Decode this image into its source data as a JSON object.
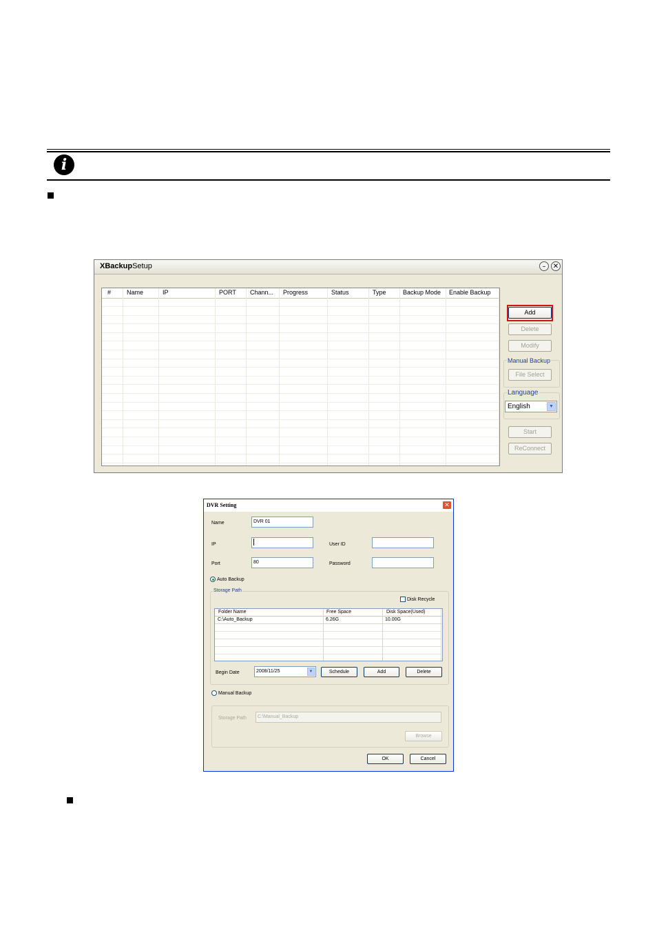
{
  "xbackup": {
    "title_bold": "XBackup",
    "title_rest": "Setup",
    "minimize_glyph": "–",
    "close_glyph": "✕",
    "columns": [
      "#",
      "Name",
      "IP",
      "PORT",
      "Chann...",
      "Progress",
      "Status",
      "Type",
      "Backup Mode",
      "Enable Backup"
    ],
    "buttons": {
      "add": "Add",
      "delete": "Delete",
      "modify": "Modify",
      "file_select": "File Select",
      "start": "Start",
      "reconnect": "ReConnect"
    },
    "manual_backup_label": "Manual Backup",
    "language_label": "Language",
    "language_value": "English"
  },
  "dvr": {
    "title": "DVR Setting",
    "close_glyph": "✕",
    "name_label": "Name",
    "name_value": "DVR 01",
    "ip_label": "IP",
    "ip_value": "",
    "userid_label": "User ID",
    "userid_value": "",
    "port_label": "Port",
    "port_value": "80",
    "password_label": "Password",
    "password_value": "",
    "auto_backup_label": "Auto Backup",
    "storage_path_label": "Storage Path",
    "disk_recycle_label": "Disk Recycle",
    "columns": [
      "Folder Name",
      "Free Space",
      "Disk Space(Used)"
    ],
    "rows": [
      {
        "folder": "C:\\Auto_Backup",
        "free": "6.26G",
        "used": "10.00G"
      }
    ],
    "begin_date_label": "Begin Date",
    "begin_date_value": "2008/11/25",
    "schedule_btn": "Schedule",
    "add_btn": "Add",
    "delete_btn": "Delete",
    "manual_backup_label": "Manual Backup",
    "manual_storage_path_label": "Storage Path",
    "manual_storage_path_value": "C:\\Manual_Backup",
    "browse_btn": "Browse",
    "ok_btn": "OK",
    "cancel_btn": "Cancel"
  }
}
